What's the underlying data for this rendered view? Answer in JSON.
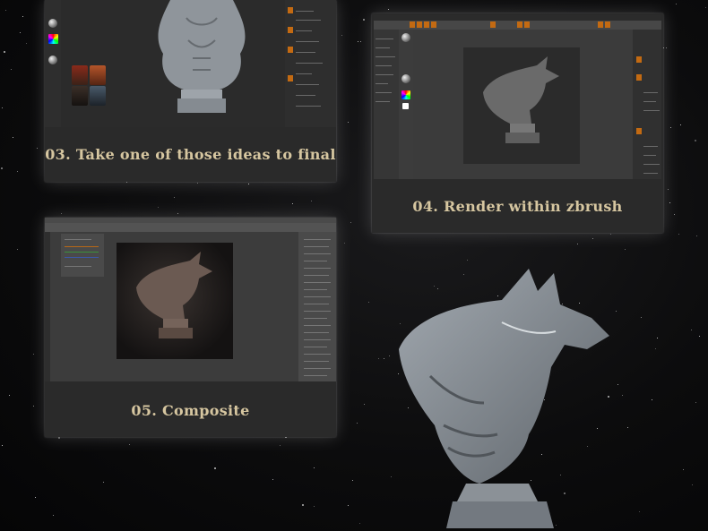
{
  "captions": {
    "step3": "03. Take one of those ideas to final",
    "step4": "04. Render within zbrush",
    "step5": "05. Composite"
  },
  "icons": {
    "app_toolbar": "toolbar-icon",
    "color_picker": "color-picker-icon",
    "material_sphere": "material-sphere-icon"
  },
  "colors": {
    "caption_text": "#d6c6a0",
    "accent_orange": "#c36a12",
    "card_bg": "#2a2a2a",
    "sculpt_gray": "#8f959b"
  }
}
